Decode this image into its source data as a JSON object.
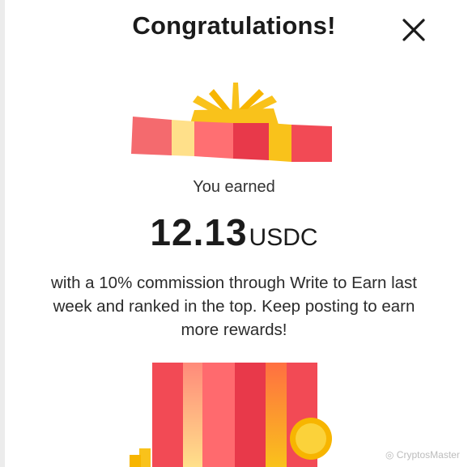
{
  "dialog": {
    "title": "Congratulations!",
    "close_icon": "close-icon",
    "earned_label": "You earned",
    "amount": "12.13",
    "currency": "USDC",
    "description": "with a 10% commission through Write to Earn last week and ranked in the top. Keep posting to earn more rewards!"
  },
  "watermark": "◎ CryptosMaster",
  "colors": {
    "gift_red": "#f24a55",
    "gift_coral": "#ff6f72",
    "gift_yellow": "#f9c21b",
    "gift_pale": "#ffe08a",
    "coin": "#f7c21a"
  }
}
